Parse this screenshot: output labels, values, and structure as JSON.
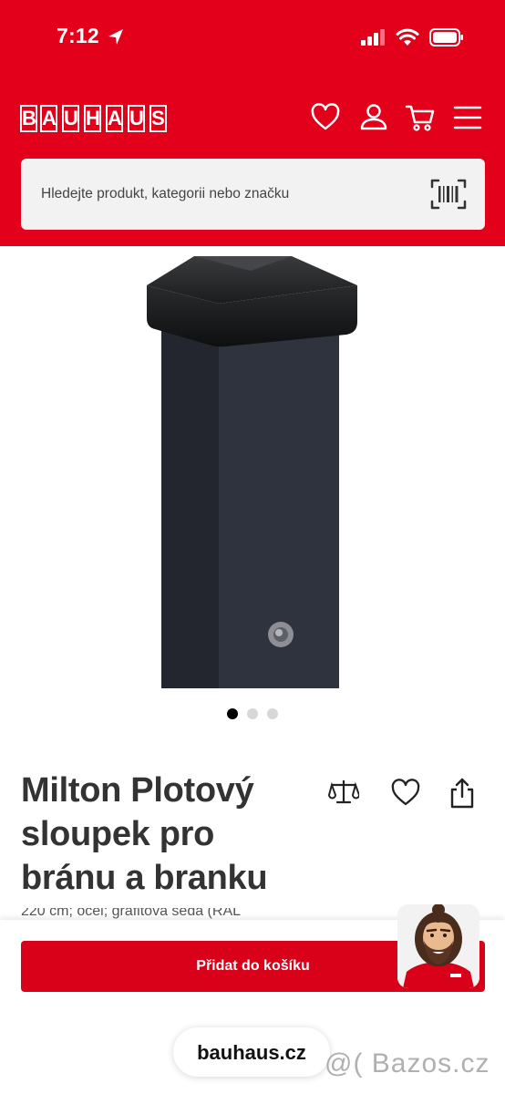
{
  "status_bar": {
    "time": "7:12",
    "icons": [
      "location-arrow-icon",
      "cellular-signal-icon",
      "wifi-icon",
      "battery-icon"
    ]
  },
  "header": {
    "brand": "BAUHAUS",
    "brand_letters": [
      "B",
      "A",
      "U",
      "H",
      "A",
      "U",
      "S"
    ],
    "icons": [
      "heart-icon",
      "user-icon",
      "cart-icon",
      "menu-icon"
    ],
    "brand_color": "#e2001a"
  },
  "search": {
    "placeholder": "Hledejte produkt, kategorii nebo značku",
    "icon": "barcode-scanner-icon"
  },
  "gallery": {
    "slide_count": 3,
    "active_slide": 1
  },
  "product": {
    "title_lines": [
      "Milton Plotový",
      "sloupek pro",
      "bránu a branku"
    ],
    "subtitle": "220 cm; ocel; grafitová šedá (RAL",
    "actions": [
      "compare-scale-icon",
      "wishlist-heart-icon",
      "share-icon"
    ]
  },
  "cart": {
    "add_label": "Přidat do košíku",
    "button_color": "#d9001a"
  },
  "browser": {
    "url": "bauhaus.cz"
  },
  "watermark": {
    "text": "@( Bazos.cz"
  }
}
